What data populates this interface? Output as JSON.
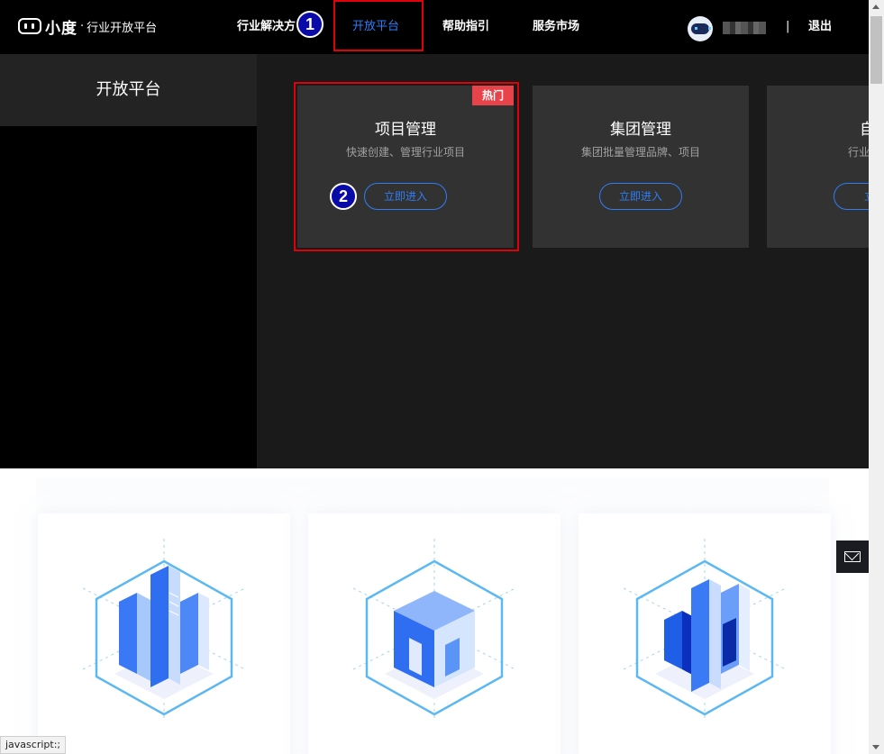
{
  "header": {
    "logo": {
      "brand": "小度",
      "separator": "·",
      "subtitle": "行业开放平台"
    },
    "nav": [
      {
        "label": "行业解决方"
      },
      {
        "label": "开放平台",
        "active": true
      },
      {
        "label": "帮助指引"
      },
      {
        "label": "服务市场"
      }
    ],
    "divider": "|",
    "logout": "退出"
  },
  "annotations": {
    "step1": "1",
    "step2": "2"
  },
  "dropdown": {
    "left_title": "开放平台",
    "cards": [
      {
        "title": "项目管理",
        "desc": "快速创建、管理行业项目",
        "button": "立即进入",
        "badge": "热门"
      },
      {
        "title": "集团管理",
        "desc": "集团批量管理品牌、项目",
        "button": "立即进入"
      },
      {
        "title": "自助",
        "desc": "行业开发者",
        "button": "立即"
      }
    ]
  },
  "status_bar": {
    "url": "javascript:;"
  },
  "colors": {
    "accent": "#2f7df6",
    "highlight_box": "#e0000a",
    "badge": "#e8434b"
  },
  "icons": [
    "mail-icon",
    "avatar"
  ]
}
